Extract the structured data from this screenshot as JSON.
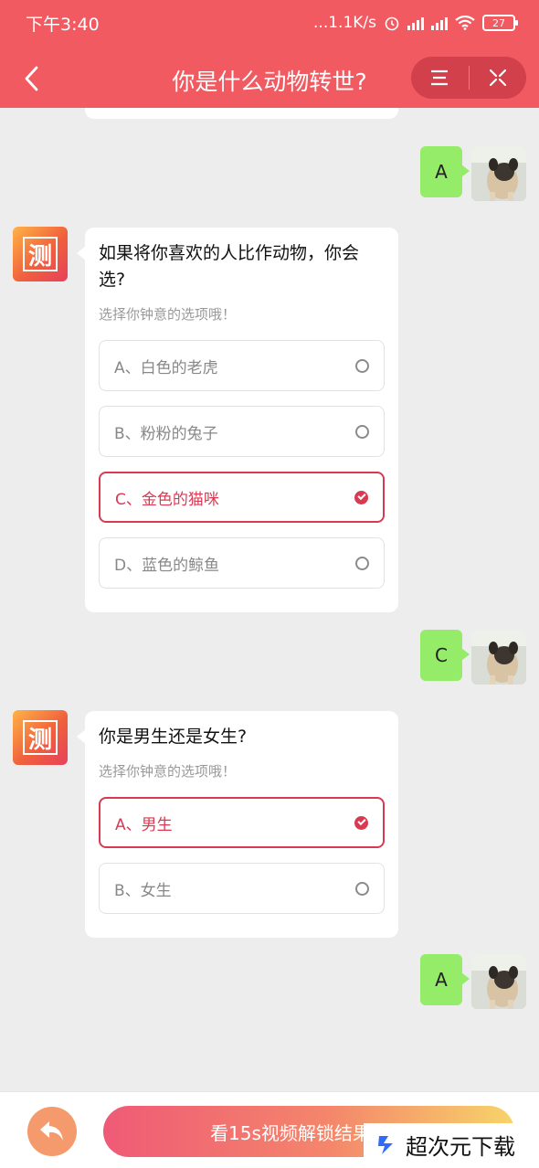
{
  "status_bar": {
    "time": "下午3:40",
    "network_speed": "...1.1K/s",
    "battery": "27"
  },
  "nav": {
    "title": "你是什么动物转世?"
  },
  "bot": {
    "avatar_char": "测"
  },
  "messages": [
    {
      "type": "user",
      "text": "A"
    },
    {
      "type": "question",
      "question": "如果将你喜欢的人比作动物，你会选?",
      "hint": "选择你钟意的选项哦！",
      "options": [
        {
          "label": "A、白色的老虎",
          "selected": false
        },
        {
          "label": "B、粉粉的兔子",
          "selected": false
        },
        {
          "label": "C、金色的猫咪",
          "selected": true
        },
        {
          "label": "D、蓝色的鲸鱼",
          "selected": false
        }
      ]
    },
    {
      "type": "user",
      "text": "C"
    },
    {
      "type": "question",
      "question": "你是男生还是女生?",
      "hint": "选择你钟意的选项哦！",
      "options": [
        {
          "label": "A、男生",
          "selected": true
        },
        {
          "label": "B、女生",
          "selected": false
        }
      ]
    },
    {
      "type": "user",
      "text": "A"
    }
  ],
  "bottom": {
    "unlock_label": "看15s视频解锁结果",
    "watermark": "超次元下载"
  },
  "colors": {
    "header": "#f25a61",
    "accent": "#d93a52",
    "user_bubble": "#95ec69"
  }
}
